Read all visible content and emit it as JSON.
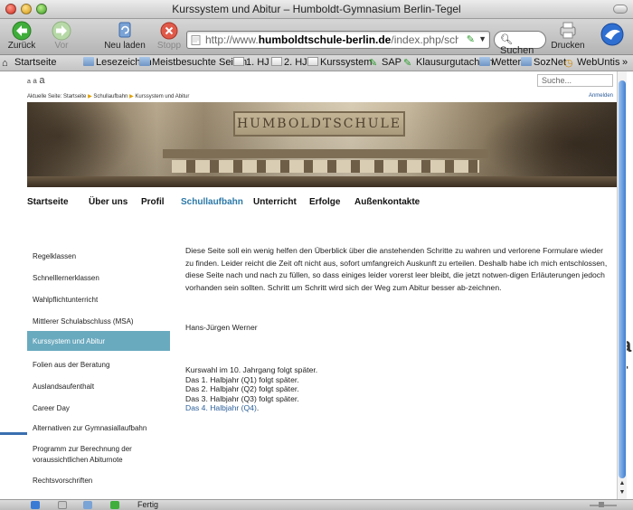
{
  "window": {
    "title": "Kurssystem und Abitur – Humboldt-Gymnasium Berlin-Tegel"
  },
  "toolbar": {
    "back_label": "Zurück",
    "forward_label": "Vor",
    "reload_label": "Neu laden",
    "stop_label": "Stopp",
    "print_label": "Drucken",
    "url_prefix": "http://www.",
    "url_domain": "humboldtschule-berlin.de",
    "url_path": "/index.php/schullaufbahn/ku",
    "search_label": "Suchen"
  },
  "bookmarks": [
    {
      "label": "Startseite",
      "icon": "home-icon"
    },
    {
      "label": "Lesezeichen",
      "icon": "folder-icon"
    },
    {
      "label": "Meistbesuchte Seiten",
      "icon": "folder-icon"
    },
    {
      "label": "1. HJ",
      "icon": "page-icon"
    },
    {
      "label": "2. HJ",
      "icon": "page-icon"
    },
    {
      "label": "Kurssystem",
      "icon": "page-icon"
    },
    {
      "label": "SAP",
      "icon": "tag-icon"
    },
    {
      "label": "Klausurgutachten",
      "icon": "tag-icon"
    },
    {
      "label": "Wetter",
      "icon": "folder-icon"
    },
    {
      "label": "SozNet",
      "icon": "folder-icon"
    },
    {
      "label": "WebUntis",
      "icon": "clock-icon"
    },
    {
      "label": "»",
      "icon": "chevron-icon"
    }
  ],
  "page": {
    "font_small": "a",
    "font_mid": "a",
    "font_large": "a",
    "search_placeholder": "Suche...",
    "breadcrumb_prefix": "Aktuelle Seite:",
    "breadcrumb": [
      "Startseite",
      "Schullaufbahn",
      "Kurssystem und Abitur"
    ],
    "login_link": "Anmelden",
    "banner_sign": "HUMBOLDTSCHULE",
    "nav": [
      {
        "label": "Startseite",
        "active": false
      },
      {
        "label": "Über uns",
        "active": false
      },
      {
        "label": "Profil",
        "active": false
      },
      {
        "label": "Schullaufbahn",
        "active": true
      },
      {
        "label": "Unterricht",
        "active": false
      },
      {
        "label": "Erfolge",
        "active": false
      },
      {
        "label": "Außenkontakte",
        "active": false
      }
    ],
    "sidebar": [
      {
        "label": "Regelklassen",
        "active": false
      },
      {
        "label": "Schnelllernerklassen",
        "active": false
      },
      {
        "label": "Wahlpflichtunterricht",
        "active": false
      },
      {
        "label": "Mittlerer Schulabschluss (MSA)",
        "active": false
      },
      {
        "label": "Kurssystem und Abitur",
        "active": true
      },
      {
        "label": "Folien aus der Beratung",
        "active": false
      },
      {
        "label": "Auslandsaufenthalt",
        "active": false
      },
      {
        "label": "Career Day",
        "active": false
      },
      {
        "label": "Alternativen zur Gymnasiallaufbahn",
        "active": false
      },
      {
        "label": "Programm zur Berechnung der",
        "label2": "voraussichtlichen Abiturnote",
        "active": false
      },
      {
        "label": "Rechtsvorschriften",
        "active": false
      }
    ],
    "paragraph": "Diese Seite soll ein wenig helfen den Überblick über die anstehenden Schritte zu wahren und verlorene Formulare wieder zu finden. Leider reicht die Zeit oft nicht aus, sofort umfangreich Auskunft zu erteilen. Deshalb habe ich mich entschlossen, diese Seite nach und nach zu füllen, so dass einiges leider vorerst leer bleibt, die jetzt notwen-digen Erläuterungen jedoch vorhanden sein sollten. Schritt um Schritt wird sich der Weg zum Abitur besser ab-zeichnen.",
    "author": "Hans-Jürgen Werner",
    "lines": [
      "Kurswahl im 10. Jahrgang folgt später.",
      "Das 1. Halbjahr (Q1) folgt später.",
      "Das 2. Halbjahr (Q2) folgt später.",
      "Das 3. Halbjahr (Q3) folgt später."
    ],
    "line_q4": "Das 4. Halbjahr (Q4)",
    "line_q4_suffix": "."
  },
  "status": {
    "text": "Fertig"
  },
  "colors": {
    "accent": "#2b78a8",
    "sidebar_active": "#6aaabf"
  }
}
